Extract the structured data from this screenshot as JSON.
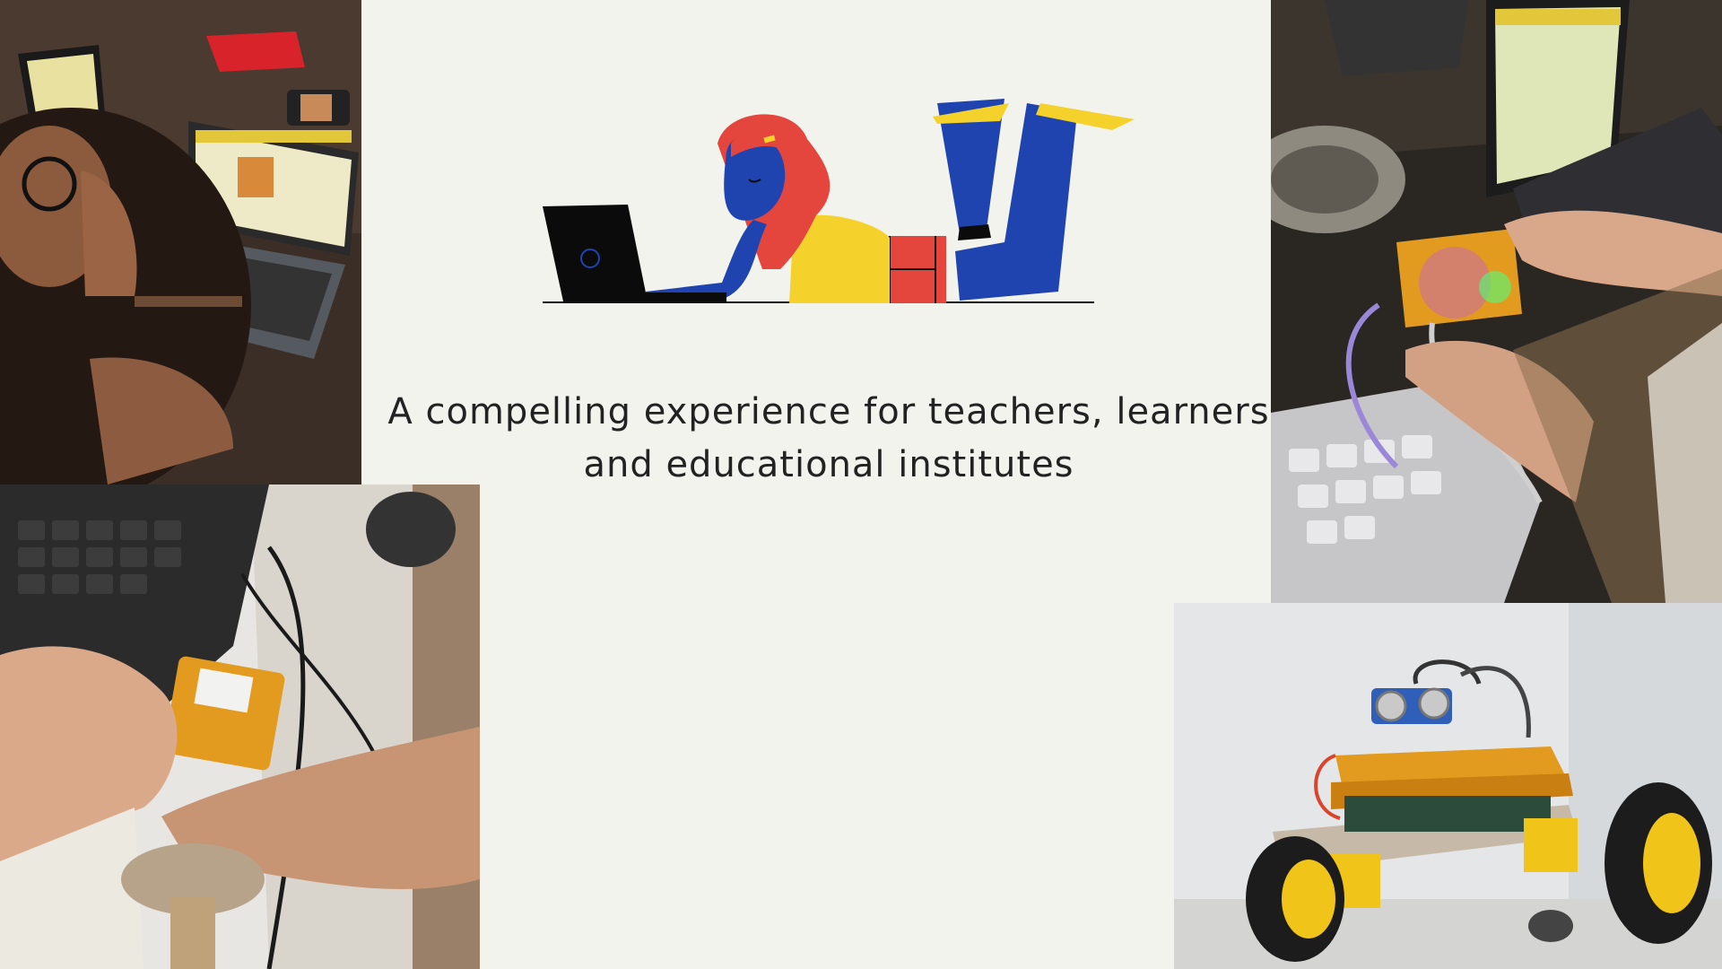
{
  "tagline": {
    "line1": "A compelling experience for teachers, learners",
    "line2": "and educational institutes"
  },
  "photos": [
    {
      "id": "top-left",
      "subject": "child-using-laptop-photo"
    },
    {
      "id": "bottom-left",
      "subject": "hands-on-circuit-board-photo"
    },
    {
      "id": "top-right",
      "subject": "hands-with-glowing-board-photo"
    },
    {
      "id": "bottom-right",
      "subject": "robot-car-photo"
    }
  ],
  "colors": {
    "background": "#f3f3ee",
    "illustration_blue": "#1f44b0",
    "illustration_yellow": "#f5d12c",
    "illustration_red": "#e4453c",
    "illustration_black": "#0b0b0b"
  }
}
